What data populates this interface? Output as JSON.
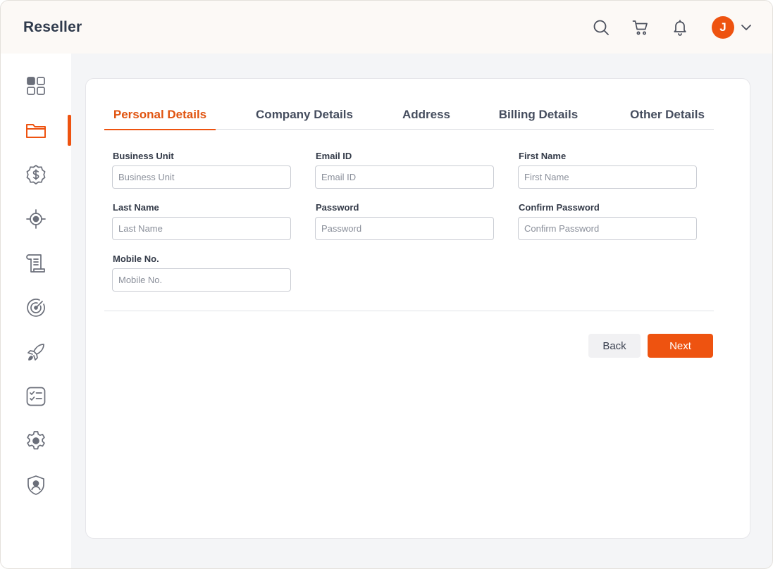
{
  "header": {
    "title": "Reseller",
    "user_initial": "J"
  },
  "icons": {
    "top": [
      "search-icon",
      "cart-icon",
      "bell-icon",
      "chevron-down-icon"
    ],
    "sidebar": [
      "dashboard-icon",
      "folder-icon",
      "dollar-badge-icon",
      "target-icon",
      "scroll-icon",
      "gauge-icon",
      "rocket-icon",
      "checklist-icon",
      "gear-icon",
      "shield-user-icon"
    ]
  },
  "sidebar": {
    "active_index": 1
  },
  "tabs": [
    {
      "label": "Personal Details",
      "active": true
    },
    {
      "label": "Company Details",
      "active": false
    },
    {
      "label": "Address",
      "active": false
    },
    {
      "label": "Billing Details",
      "active": false
    },
    {
      "label": "Other Details",
      "active": false
    }
  ],
  "form": {
    "business_unit": {
      "label": "Business Unit",
      "placeholder": "Business Unit",
      "value": ""
    },
    "email_id": {
      "label": "Email ID",
      "placeholder": "Email ID",
      "value": ""
    },
    "first_name": {
      "label": "First Name",
      "placeholder": "First Name",
      "value": ""
    },
    "last_name": {
      "label": "Last Name",
      "placeholder": "Last Name",
      "value": ""
    },
    "password": {
      "label": "Password",
      "placeholder": "Password",
      "value": ""
    },
    "confirm_password": {
      "label": "Confirm Password",
      "placeholder": "Confirm Password",
      "value": ""
    },
    "mobile_no": {
      "label": "Mobile No.",
      "placeholder": "Mobile No.",
      "value": ""
    }
  },
  "actions": {
    "back_label": "Back",
    "next_label": "Next"
  },
  "colors": {
    "accent": "#ee5310",
    "topbar_bg": "#fcf9f6",
    "page_bg": "#f4f5f7",
    "icon_gray": "#6b6f7a"
  }
}
